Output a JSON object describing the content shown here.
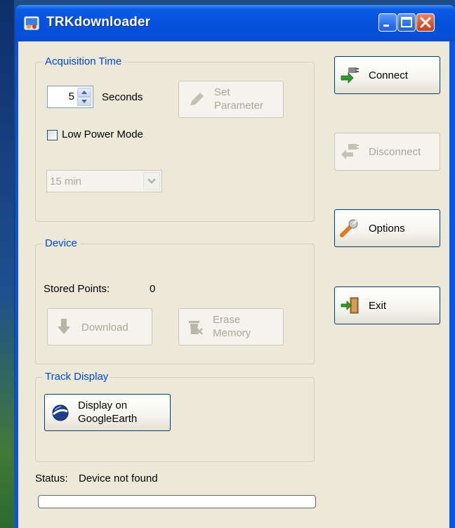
{
  "window": {
    "title": "TRKdownloader"
  },
  "acquisition": {
    "group_label": "Acquisition Time",
    "seconds_value": "5",
    "seconds_label": "Seconds",
    "set_parameter_label_line1": "Set",
    "set_parameter_label_line2": "Parameter",
    "low_power_label": "Low Power Mode",
    "low_power_checked": false,
    "interval_value": "15 min"
  },
  "device": {
    "group_label": "Device",
    "stored_points_label": "Stored Points:",
    "stored_points_value": "0",
    "download_label": "Download",
    "erase_label_line1": "Erase",
    "erase_label_line2": "Memory"
  },
  "track": {
    "group_label": "Track Display",
    "display_label_line1": "Display on",
    "display_label_line2": "GoogleEarth"
  },
  "side_buttons": {
    "connect": "Connect",
    "disconnect": "Disconnect",
    "options": "Options",
    "exit": "Exit"
  },
  "status": {
    "label": "Status:",
    "text": "Device not found",
    "progress": 0
  },
  "colors": {
    "accent": "#0046d5",
    "titlebar": "#0753de",
    "client_bg": "#ece9d8"
  }
}
